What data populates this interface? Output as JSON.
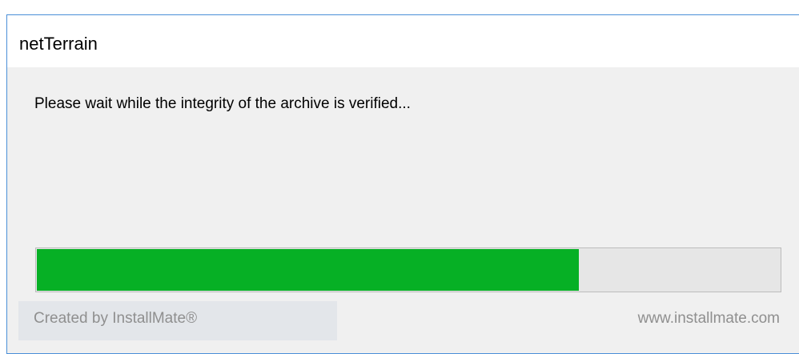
{
  "window": {
    "title": "netTerrain"
  },
  "main": {
    "message": "Please wait while the integrity of the archive is verified..."
  },
  "progress": {
    "percent": 73,
    "fill_color": "#06b025",
    "track_color": "#e6e6e6"
  },
  "footer": {
    "created_by": "Created by InstallMate®",
    "website": "www.installmate.com"
  },
  "colors": {
    "window_border": "#4a8fd8",
    "body_background": "#f0f0f0",
    "footer_text": "#8f8f8f"
  }
}
